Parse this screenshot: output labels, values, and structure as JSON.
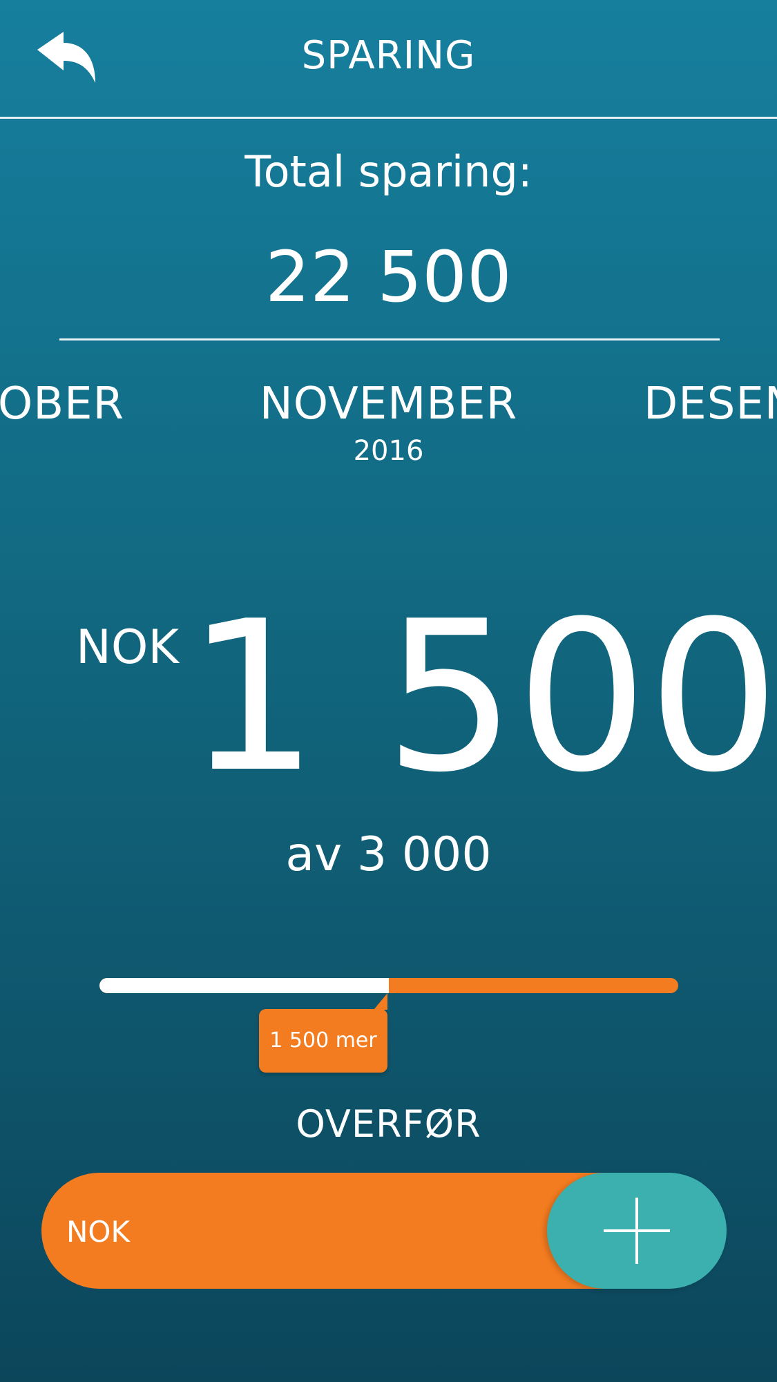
{
  "header": {
    "title": "SPARING",
    "back_icon": "reply-arrow-icon"
  },
  "totals": {
    "label": "Total sparing:",
    "value": "22 500"
  },
  "months": {
    "previous": "OBER",
    "current": "NOVEMBER",
    "year": "2016",
    "next": "DESEN"
  },
  "savings": {
    "currency": "NOK",
    "amount": "1 500",
    "goal_text": "av 3 000",
    "progress_fraction": 0.5,
    "remaining_label": "1 500 mer"
  },
  "transfer": {
    "label": "OVERFØR",
    "input_placeholder": "NOK",
    "add_icon": "plus-icon"
  },
  "colors": {
    "background_top": "#167f9e",
    "background_bottom": "#0c465b",
    "accent_orange": "#f47c20",
    "accent_teal": "#3cb0ae",
    "text": "#ffffff"
  }
}
